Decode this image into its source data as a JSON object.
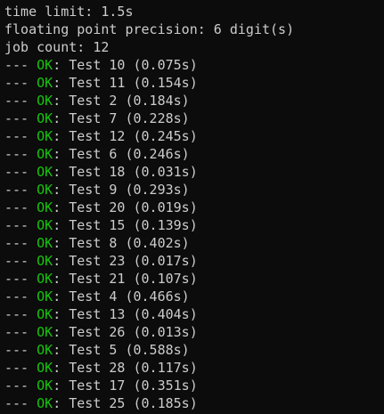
{
  "terminal": {
    "clipped_top_line": "---------------------------------------------------------",
    "header_lines": [
      "time limit: 1.5s",
      "floating point precision: 6 digit(s)",
      "job count: 12"
    ],
    "result_prefix": "--- ",
    "result_separator": ": ",
    "ok_color": "#16c60c",
    "text_color": "#cccccc",
    "background_color": "#0c0c0c",
    "results": [
      {
        "status": "OK",
        "detail": "Test 10 (0.075s)"
      },
      {
        "status": "OK",
        "detail": "Test 11 (0.154s)"
      },
      {
        "status": "OK",
        "detail": "Test 2 (0.184s)"
      },
      {
        "status": "OK",
        "detail": "Test 7 (0.228s)"
      },
      {
        "status": "OK",
        "detail": "Test 12 (0.245s)"
      },
      {
        "status": "OK",
        "detail": "Test 6 (0.246s)"
      },
      {
        "status": "OK",
        "detail": "Test 18 (0.031s)"
      },
      {
        "status": "OK",
        "detail": "Test 9 (0.293s)"
      },
      {
        "status": "OK",
        "detail": "Test 20 (0.019s)"
      },
      {
        "status": "OK",
        "detail": "Test 15 (0.139s)"
      },
      {
        "status": "OK",
        "detail": "Test 8 (0.402s)"
      },
      {
        "status": "OK",
        "detail": "Test 23 (0.017s)"
      },
      {
        "status": "OK",
        "detail": "Test 21 (0.107s)"
      },
      {
        "status": "OK",
        "detail": "Test 4 (0.466s)"
      },
      {
        "status": "OK",
        "detail": "Test 13 (0.404s)"
      },
      {
        "status": "OK",
        "detail": "Test 26 (0.013s)"
      },
      {
        "status": "OK",
        "detail": "Test 5 (0.588s)"
      },
      {
        "status": "OK",
        "detail": "Test 28 (0.117s)"
      },
      {
        "status": "OK",
        "detail": "Test 17 (0.351s)"
      },
      {
        "status": "OK",
        "detail": "Test 25 (0.185s)"
      }
    ]
  }
}
